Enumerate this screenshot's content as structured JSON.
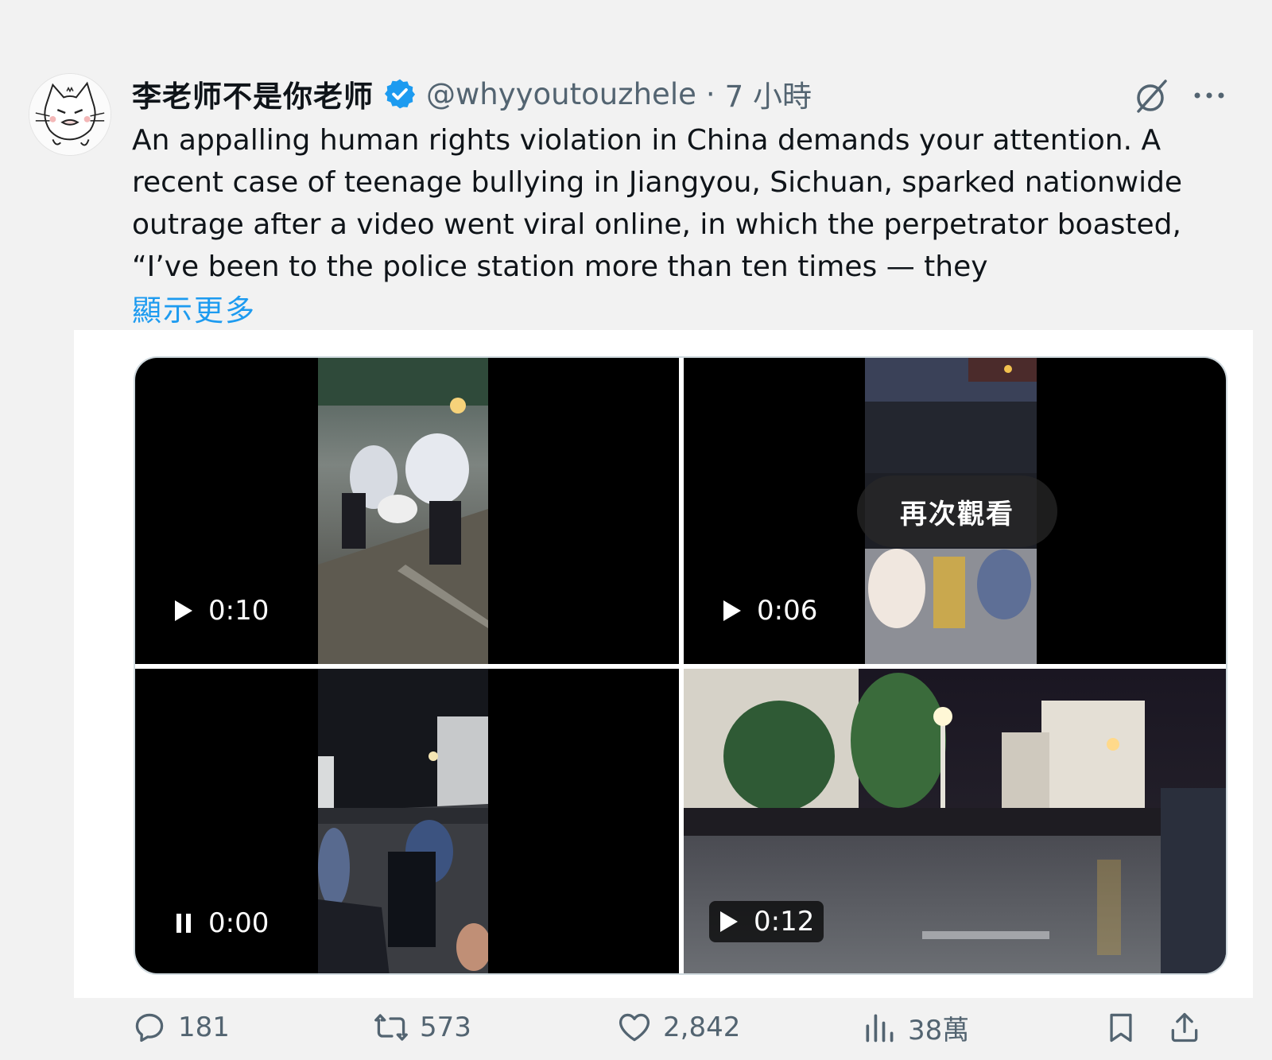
{
  "tweet": {
    "display_name": "李老师不是你老师",
    "handle": "@whyyoutouzhele",
    "separator": "·",
    "time": "7 小時",
    "text": "An appalling human rights violation in China demands your attention. A recent case of teenage bullying in Jiangyou, Sichuan, sparked nationwide outrage after a video went viral online, in which the perpetrator boasted, “I’ve been to the police station more than ten times — they",
    "show_more": "顯示更多"
  },
  "media": {
    "videos": [
      {
        "duration": "0:10",
        "state": "play"
      },
      {
        "duration": "0:06",
        "state": "play",
        "overlay": "再次觀看"
      },
      {
        "duration": "0:00",
        "state": "pause"
      },
      {
        "duration": "0:12",
        "state": "play"
      }
    ]
  },
  "actions": {
    "replies": "181",
    "reposts": "573",
    "likes": "2,842",
    "views": "38萬"
  },
  "icons": {
    "verified": "verified-badge-icon",
    "grok": "grok-icon",
    "more": "more-icon",
    "reply": "reply-icon",
    "repost": "repost-icon",
    "like": "like-icon",
    "views": "views-icon",
    "bookmark": "bookmark-icon",
    "share": "share-icon"
  },
  "colors": {
    "accent": "#1d9bf0",
    "secondary_text": "#536471",
    "primary_text": "#0f1419",
    "background": "#f2f2f2"
  }
}
